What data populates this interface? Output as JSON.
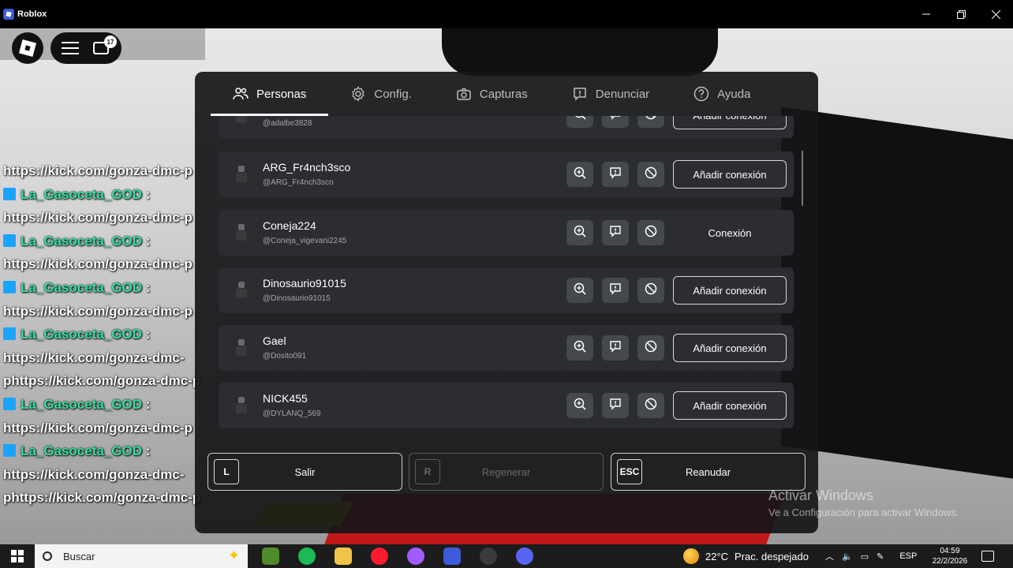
{
  "window": {
    "title": "Roblox",
    "controls": [
      "minimize-icon",
      "maximize-icon",
      "close-icon"
    ]
  },
  "hud": {
    "chat_badge": "17"
  },
  "chat": {
    "lines": [
      {
        "kind": "url",
        "text": "https://kick.com/gonza-dmc-p"
      },
      {
        "kind": "name",
        "text": "La_Gasoceta_GOD",
        "suffix": " :"
      },
      {
        "kind": "url",
        "text": "https://kick.com/gonza-dmc-p"
      },
      {
        "kind": "name",
        "text": "La_Gasoceta_GOD",
        "suffix": " :"
      },
      {
        "kind": "url",
        "text": "https://kick.com/gonza-dmc-p"
      },
      {
        "kind": "name",
        "text": "La_Gasoceta_GOD",
        "suffix": " :"
      },
      {
        "kind": "url",
        "text": "https://kick.com/gonza-dmc-p"
      },
      {
        "kind": "name",
        "text": "La_Gasoceta_GOD",
        "suffix": " :"
      },
      {
        "kind": "url",
        "text": "https://kick.com/gonza-dmc-"
      },
      {
        "kind": "url",
        "text": "phttps://kick.com/gonza-dmc-p"
      },
      {
        "kind": "name",
        "text": "La_Gasoceta_GOD",
        "suffix": " :"
      },
      {
        "kind": "url",
        "text": "https://kick.com/gonza-dmc-p"
      },
      {
        "kind": "name",
        "text": "La_Gasoceta_GOD",
        "suffix": " :"
      },
      {
        "kind": "url",
        "text": "https://kick.com/gonza-dmc-"
      },
      {
        "kind": "url",
        "text": "phttps://kick.com/gonza-dmc-p"
      }
    ]
  },
  "menu": {
    "tabs": [
      {
        "label": "Personas",
        "icon": "people-icon",
        "active": true
      },
      {
        "label": "Config.",
        "icon": "gear-icon",
        "active": false
      },
      {
        "label": "Capturas",
        "icon": "camera-icon",
        "active": false
      },
      {
        "label": "Denunciar",
        "icon": "report-icon",
        "active": false
      },
      {
        "label": "Ayuda",
        "icon": "help-icon",
        "active": false
      }
    ],
    "players": [
      {
        "name": "",
        "username": "@adalbe3828",
        "action": "Añadir conexión",
        "action_style": "outlined"
      },
      {
        "name": "ARG_Fr4nch3sco",
        "username": "@ARG_Fr4nch3sco",
        "action": "Añadir conexión",
        "action_style": "outlined"
      },
      {
        "name": "Coneja224",
        "username": "@Coneja_vigevani2245",
        "action": "Conexión",
        "action_style": "plain"
      },
      {
        "name": "Dinosaurio91015",
        "username": "@Dinosaurio91015",
        "action": "Añadir conexión",
        "action_style": "outlined"
      },
      {
        "name": "Gael",
        "username": "@Dosito091",
        "action": "Añadir conexión",
        "action_style": "outlined"
      },
      {
        "name": "NICK455",
        "username": "@DYLANQ_569",
        "action": "Añadir conexión",
        "action_style": "outlined"
      }
    ],
    "buttons": [
      {
        "key": "L",
        "label": "Salir",
        "enabled": true
      },
      {
        "key": "R",
        "label": "Regenerar",
        "enabled": false
      },
      {
        "key": "ESC",
        "label": "Reanudar",
        "enabled": true
      }
    ]
  },
  "watermark": {
    "title": "Activar Windows",
    "subtitle": "Ve a Configuración para activar Windows."
  },
  "taskbar": {
    "search_placeholder": "Buscar",
    "apps": [
      "minecraft-icon",
      "spotify-icon",
      "file-explorer-icon",
      "opera-icon",
      "messenger-icon",
      "roblox-icon",
      "obs-icon",
      "discord-icon"
    ],
    "weather_temp": "22°C",
    "weather_text": "Prac. despejado",
    "language": "ESP",
    "time": "04:59",
    "date": "22/2/2026"
  }
}
